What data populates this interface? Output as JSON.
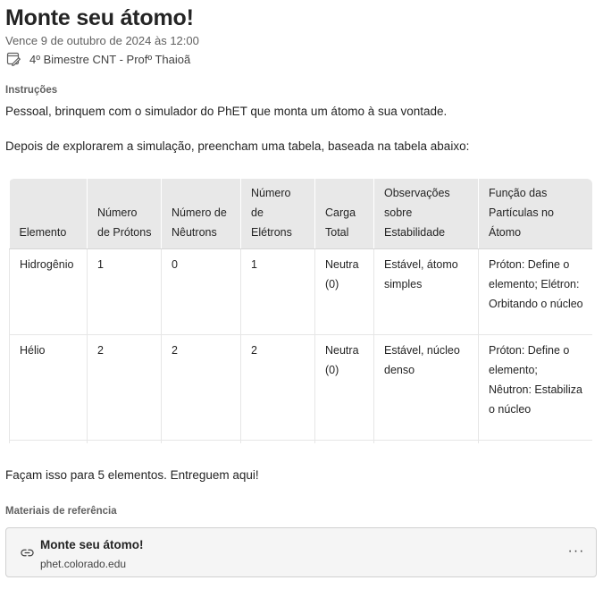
{
  "assignment": {
    "title": "Monte seu átomo!",
    "due": "Vence 9 de outubro de 2024 às 12:00",
    "class_name": "4º Bimestre CNT - Profº Thaioã",
    "class_icon": "edit-calendar-icon"
  },
  "instructions": {
    "label": "Instruções",
    "paragraph1": "Pessoal, brinquem com o simulador do PhET que monta um átomo à sua vontade.",
    "paragraph2": "Depois de explorarem a simulação, preencham uma tabela, baseada na tabela abaixo:",
    "paragraph3": "Façam isso para 5 elementos. Entreguem aqui!"
  },
  "table": {
    "headers": [
      "Elemento",
      "Número de Prótons",
      "Número de Nêutrons",
      "Número de Elétrons",
      "Carga Total",
      "Observações sobre Estabilidade",
      "Função das Partículas no Átomo"
    ],
    "rows": [
      [
        "Hidrogênio",
        "1",
        "0",
        "1",
        "Neutra (0)",
        "Estável, átomo simples",
        "Próton: Define o elemento; Elétron: Orbitando o núcleo"
      ],
      [
        "Hélio",
        "2",
        "2",
        "2",
        "Neutra (0)",
        "Estável, núcleo denso",
        "Próton: Define o elemento; Nêutron: Estabiliza o núcleo"
      ]
    ]
  },
  "references": {
    "label": "Materiais de referência",
    "items": [
      {
        "title": "Monte seu átomo!",
        "url": "phet.colorado.edu",
        "icon": "link-icon",
        "menu_label": "···"
      }
    ]
  }
}
